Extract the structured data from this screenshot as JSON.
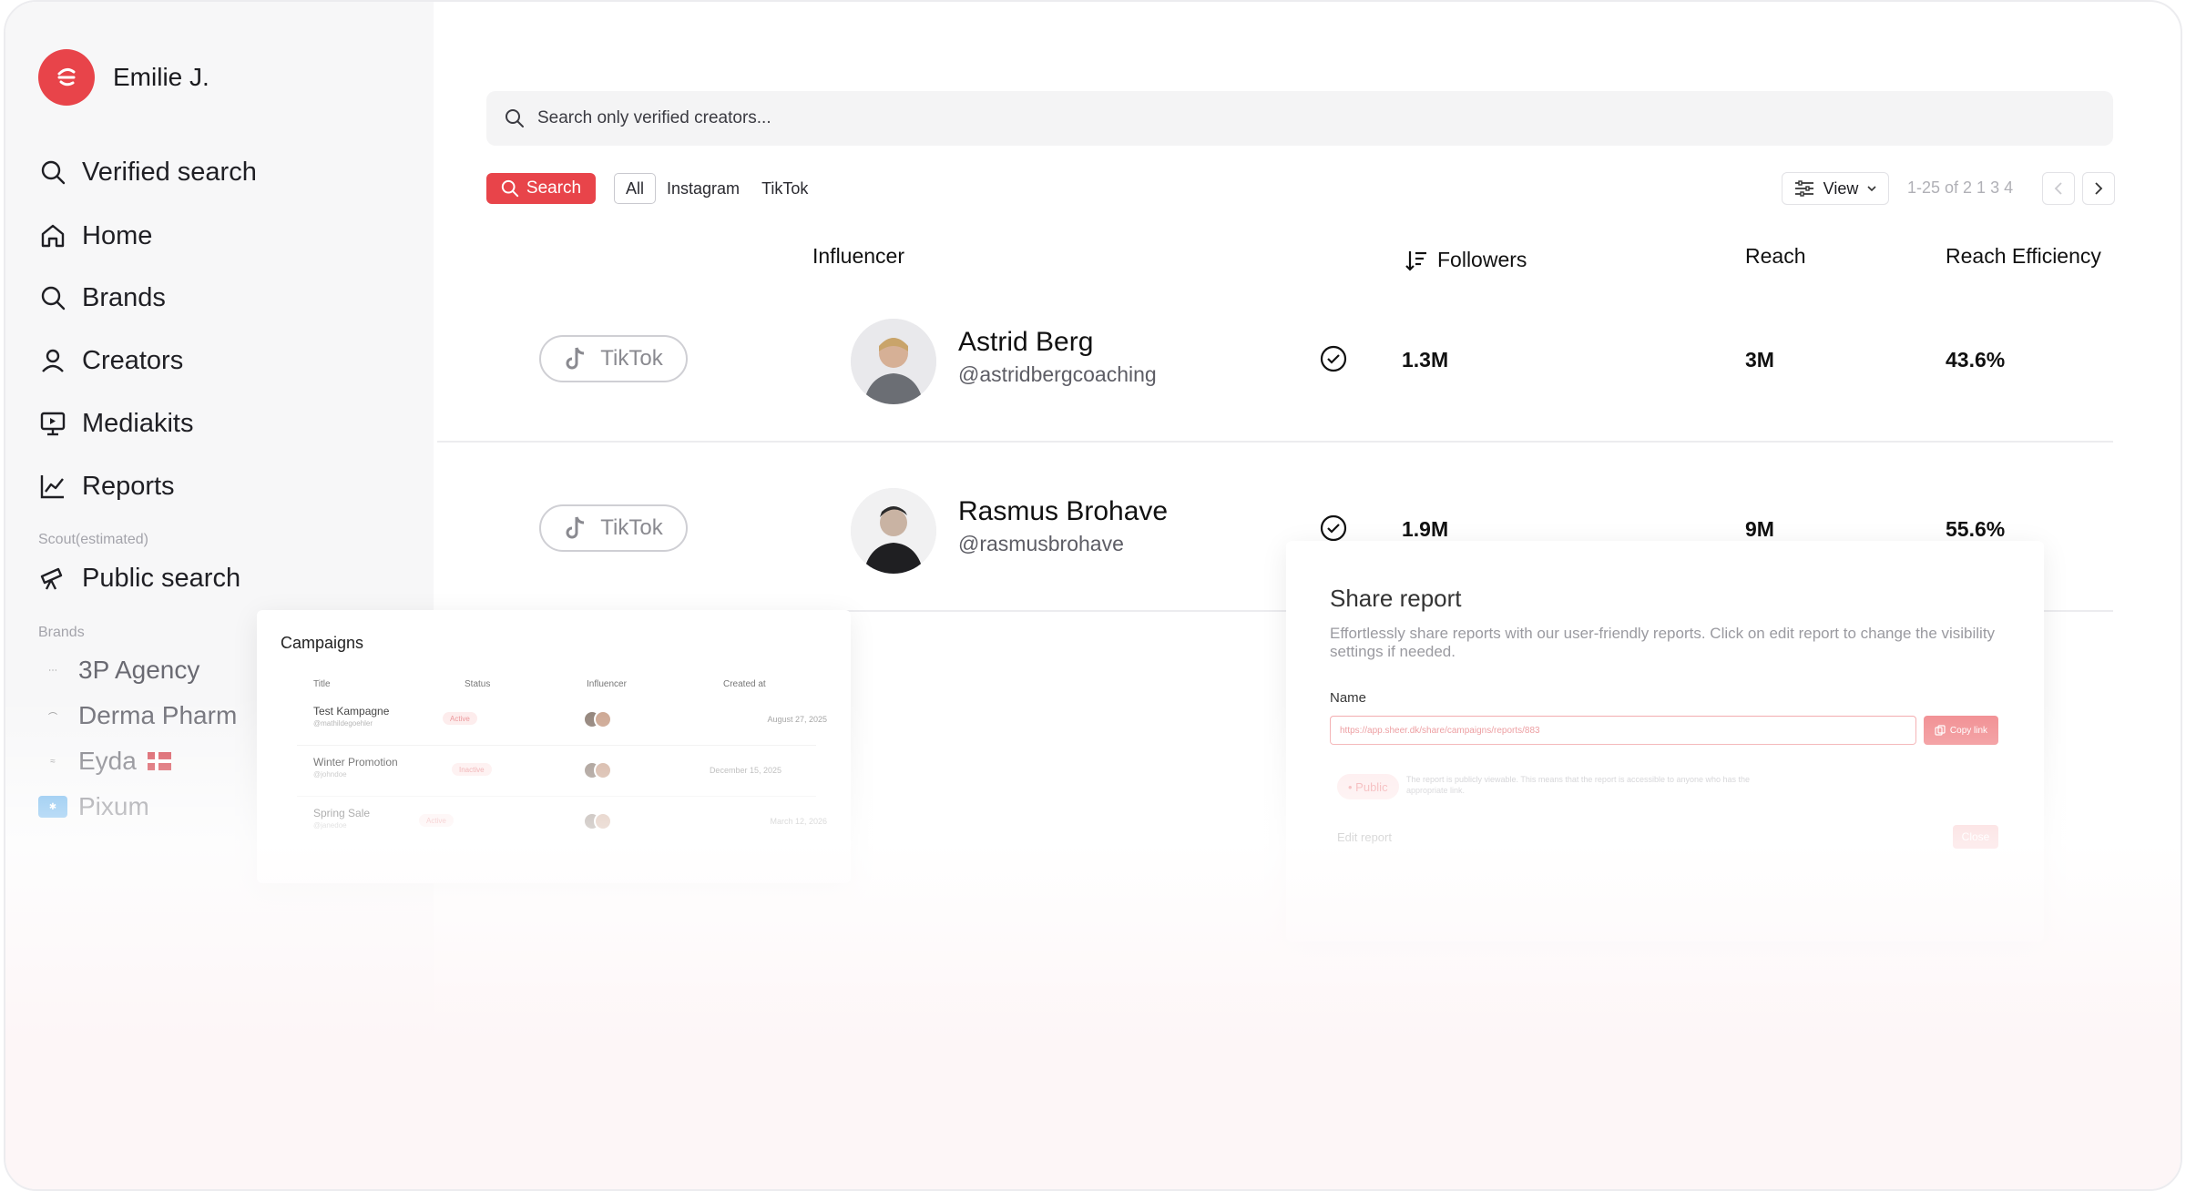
{
  "user": {
    "name": "Emilie J."
  },
  "nav": [
    {
      "label": "Verified search",
      "icon": "search-icon"
    },
    {
      "label": "Home",
      "icon": "home-icon"
    },
    {
      "label": "Brands",
      "icon": "search-icon"
    },
    {
      "label": "Creators",
      "icon": "user-icon"
    },
    {
      "label": "Mediakits",
      "icon": "presentation-icon"
    },
    {
      "label": "Reports",
      "icon": "chart-icon"
    }
  ],
  "scout": {
    "section_label": "Scout(estimated)",
    "item_label": "Public search"
  },
  "brands": {
    "section_label": "Brands",
    "items": [
      {
        "label": "3P Agency"
      },
      {
        "label": "Derma Pharm"
      },
      {
        "label": "Eyda"
      },
      {
        "label": "Pixum"
      }
    ]
  },
  "search": {
    "placeholder": "Search only verified creators...",
    "button_label": "Search"
  },
  "filters": [
    "All",
    "Instagram",
    "TikTok"
  ],
  "toolbar": {
    "view_label": "View",
    "pagination": "1-25 of 2 1 3 4"
  },
  "table": {
    "headers": {
      "influencer": "Influencer",
      "followers": "Followers",
      "reach": "Reach",
      "reach_efficiency": "Reach Efficiency"
    },
    "rows": [
      {
        "platform": "TikTok",
        "name": "Astrid Berg",
        "handle": "@astridbergcoaching",
        "followers": "1.3M",
        "reach": "3M",
        "efficiency": "43.6%"
      },
      {
        "platform": "TikTok",
        "name": "Rasmus Brohave",
        "handle": "@rasmusbrohave",
        "followers": "1.9M",
        "reach": "9M",
        "efficiency": "55.6%"
      }
    ]
  },
  "campaigns": {
    "title": "Campaigns",
    "headers": {
      "title": "Title",
      "status": "Status",
      "influencer": "Influencer",
      "created_at": "Created at"
    },
    "rows": [
      {
        "title": "Test Kampagne",
        "sub": "@mathildegoehler",
        "status": "Active",
        "date": "August 27, 2025"
      },
      {
        "title": "Winter Promotion",
        "sub": "@johndoe",
        "status": "Inactive",
        "date": "December 15, 2025"
      },
      {
        "title": "Spring Sale",
        "sub": "@janedoe",
        "status": "Active",
        "date": "March 12, 2026"
      }
    ]
  },
  "share": {
    "title": "Share report",
    "description": "Effortlessly share reports with our user-friendly reports. Click on edit report to change the visibility settings if needed.",
    "name_label": "Name",
    "url": "https://app.sheer.dk/share/campaigns/reports/883",
    "copy_label": "Copy link",
    "public_label": "• Public",
    "public_desc": "The report is publicly viewable. This means that the report is accessible to anyone who has the appropriate link.",
    "edit_label": "Edit report",
    "close_label": "Close"
  },
  "colors": {
    "accent": "#e8444a",
    "sidebar_bg": "#f7f7f8"
  }
}
